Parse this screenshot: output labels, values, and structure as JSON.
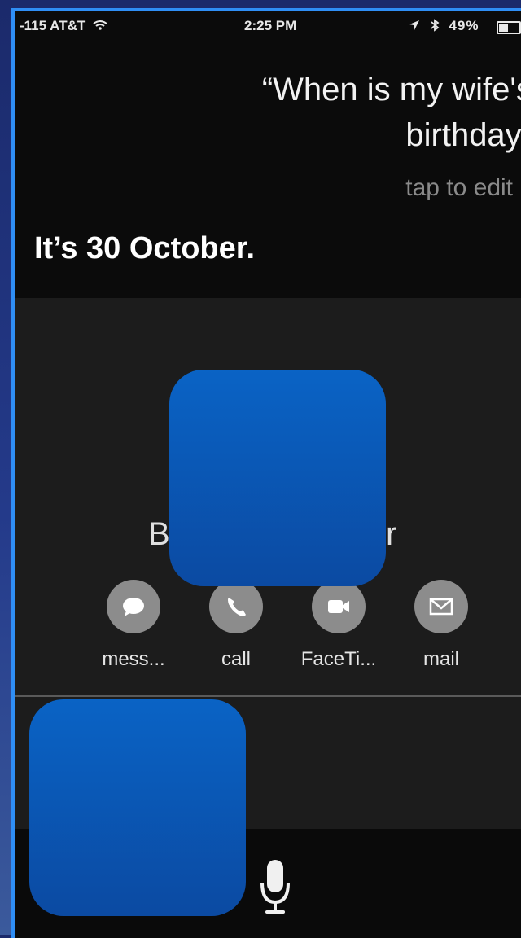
{
  "status_bar": {
    "carrier": "-115 AT&T",
    "time": "2:25 PM",
    "right": "49%"
  },
  "siri": {
    "query_line1": "“When is my wife's",
    "query_line2": "birthday”",
    "tap_to_edit": "tap to edit",
    "answer": "It’s 30 October."
  },
  "contact": {
    "name_start": "B",
    "name_end": "r",
    "actions": [
      {
        "label": "mess...",
        "icon": "message-icon"
      },
      {
        "label": "call",
        "icon": "phone-icon"
      },
      {
        "label": "FaceTi...",
        "icon": "video-icon"
      },
      {
        "label": "mail",
        "icon": "mail-icon"
      }
    ]
  },
  "colors": {
    "accent_border": "#2f8ef5",
    "redaction": "#0b5bb8",
    "action_circle": "#8c8c8c"
  }
}
